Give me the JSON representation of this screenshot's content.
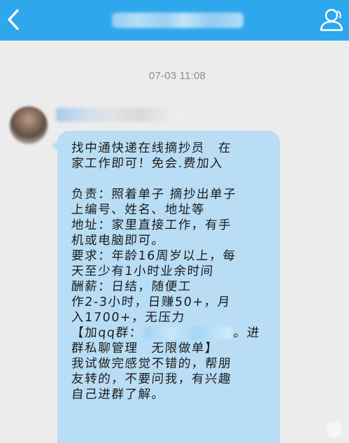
{
  "header": {
    "title": "",
    "back_icon": "chevron-left-icon",
    "profile_icon": "person-profile-icon",
    "bar_color": "#2ea7ec"
  },
  "conversation": {
    "timestamp": "07-03 11:08",
    "sender_name": "",
    "message": {
      "lines": [
        "找中通快递在线摘抄员　在",
        "家工作即可！免会.费加入",
        "",
        "负责：照着单子 摘抄出单子",
        "上编号、姓名、地址等",
        "地址：家里直接工作，有手",
        "机或电脑即可。",
        "要求：年龄16周岁以上，每",
        "天至少有1小时业余时间",
        "酬薪：日结，随便工",
        "作2-3小时，日赚50+，月",
        "入1700+，无压力"
      ],
      "qq_prefix": "【加qq群：",
      "qq_suffix": "。进",
      "tail_lines": [
        "群私聊管理　无限做单】",
        "我试做完感觉不错的，帮朋",
        "友转的，不要问我，有兴趣",
        "自己进群了解。"
      ]
    },
    "bubble_color": "#b8ddf5"
  }
}
